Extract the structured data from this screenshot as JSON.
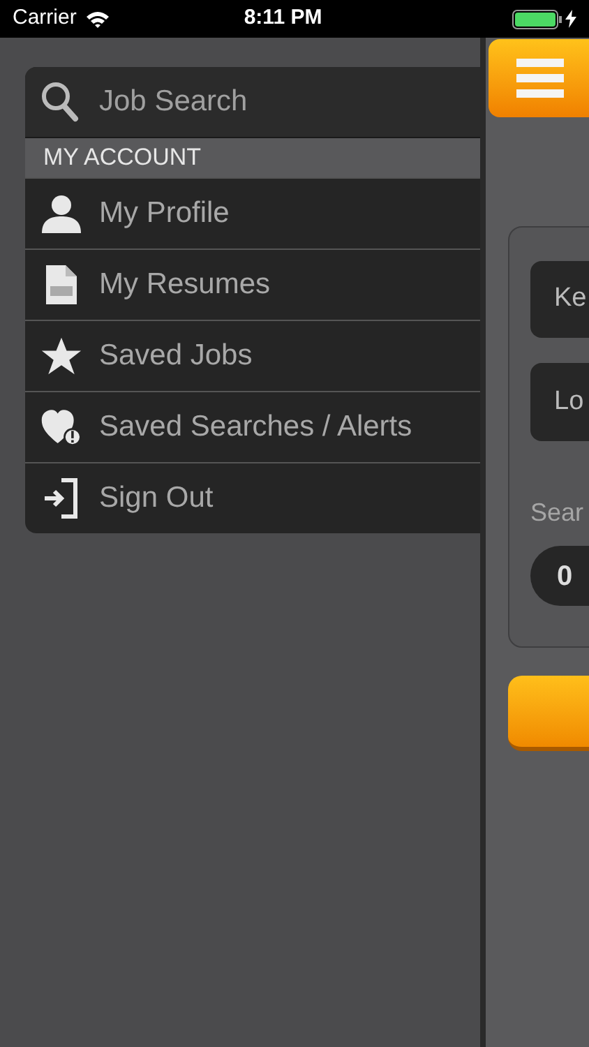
{
  "status_bar": {
    "carrier": "Carrier",
    "time": "8:11 PM"
  },
  "menu": {
    "search_item": {
      "label": "Job Search"
    },
    "section_header": "MY ACCOUNT",
    "items": [
      {
        "label": "My Profile",
        "kind": "profile"
      },
      {
        "label": "My Resumes",
        "kind": "resume"
      },
      {
        "label": "Saved Jobs",
        "kind": "star"
      },
      {
        "label": "Saved Searches / Alerts",
        "kind": "heart-alert"
      },
      {
        "label": "Sign Out",
        "kind": "sign-out"
      }
    ]
  },
  "main": {
    "keyword_field": {
      "placeholder": "Ke"
    },
    "location_field": {
      "placeholder": "Lo"
    },
    "search_label": "Sear",
    "count": "0"
  }
}
